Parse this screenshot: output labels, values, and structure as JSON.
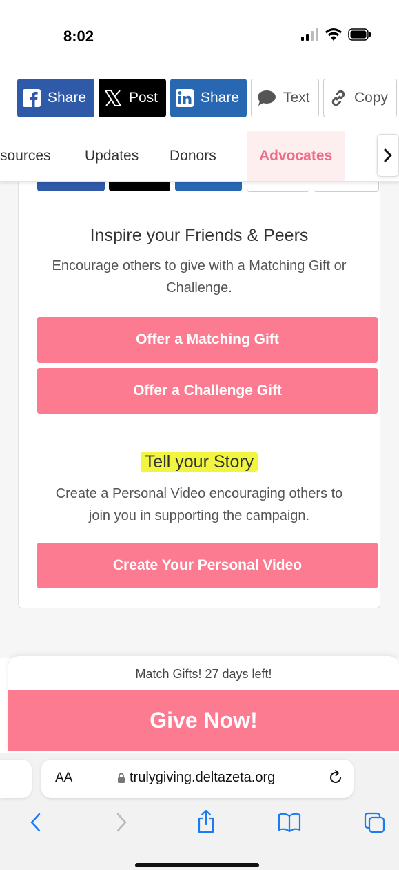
{
  "status_bar": {
    "time": "8:02"
  },
  "share_bar": {
    "facebook_label": "Share",
    "x_label": "Post",
    "linkedin_label": "Share",
    "text_label": "Text",
    "copy_label": "Copy"
  },
  "tabs": {
    "items": [
      "sources",
      "Updates",
      "Donors",
      "Advocates"
    ],
    "active": "Advocates"
  },
  "inspire": {
    "heading": "Inspire your Friends & Peers",
    "line1": "Encourage others to give with a Matching Gift or",
    "line2": "Challenge.",
    "matching_button": "Offer a Matching Gift",
    "challenge_button": "Offer a Challenge Gift"
  },
  "story": {
    "heading": "Tell your Story",
    "line1": "Create a Personal Video encouraging others to",
    "line2": "join you in supporting the campaign.",
    "video_button": "Create Your Personal Video"
  },
  "give": {
    "note": "Match Gifts! 27 days left!",
    "button": "Give Now!"
  },
  "browser": {
    "aa_label": "AA",
    "url": "trulygiving.deltazeta.org"
  },
  "colors": {
    "accent_pink": "#fd7b91",
    "facebook_blue": "#2f5aa8",
    "linkedin_blue": "#2867b2",
    "highlight_yellow": "#f2f53f",
    "ios_blue": "#1a7cf5"
  }
}
